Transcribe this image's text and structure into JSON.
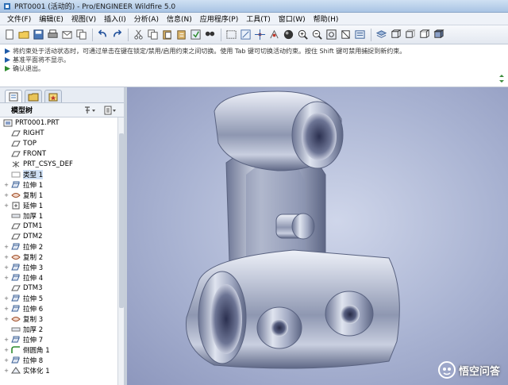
{
  "window": {
    "title": "PRT0001 (活动的) - Pro/ENGINEER Wildfire 5.0"
  },
  "menu": {
    "items": [
      "文件(F)",
      "编辑(E)",
      "视图(V)",
      "插入(I)",
      "分析(A)",
      "信息(N)",
      "应用程序(P)",
      "工具(T)",
      "窗口(W)",
      "帮助(H)"
    ]
  },
  "toolbar": {
    "icons": [
      "new-icon",
      "open-icon",
      "save-icon",
      "print-icon",
      "email-icon",
      "copy-icon",
      "undo-icon",
      "redo-icon",
      "cut-icon",
      "copy-icon",
      "paste-icon",
      "paste-special-icon",
      "regenerate-icon",
      "find-icon",
      "select-box-icon",
      "repaint-icon",
      "spin-center-icon",
      "orient-icon",
      "appearance-icon",
      "zoom-in-icon",
      "zoom-out-icon",
      "refit-icon",
      "reorient-icon",
      "saved-views-icon",
      "layers-icon",
      "wireframe-icon",
      "hidden-line-icon",
      "no-hidden-icon",
      "shading-icon"
    ]
  },
  "messages": {
    "lines": [
      "将约束处于活动状态时，可通过单击在键在锁定/禁用/启用约束之间切换。使用 Tab 键可切换活动约束。按住 Shift 键可禁用捕捉到新约束。",
      "基准平面将不显示。",
      "确认退出。"
    ]
  },
  "navigator": {
    "tabs": [
      "model-tree-tab-icon",
      "folder-browser-tab-icon",
      "favorites-tab-icon"
    ]
  },
  "model_tree": {
    "title": "模型树",
    "items": [
      {
        "label": "PRT0001.PRT",
        "icon": "part-icon",
        "expandable": false,
        "root": true
      },
      {
        "label": "RIGHT",
        "icon": "datum-plane-icon",
        "expandable": false
      },
      {
        "label": "TOP",
        "icon": "datum-plane-icon",
        "expandable": false
      },
      {
        "label": "FRONT",
        "icon": "datum-plane-icon",
        "expandable": false
      },
      {
        "label": "PRT_CSYS_DEF",
        "icon": "csys-icon",
        "expandable": false
      },
      {
        "label": "类型 1",
        "icon": "type-icon",
        "expandable": false,
        "selected": true
      },
      {
        "label": "拉伸 1",
        "icon": "extrude-icon",
        "expandable": true
      },
      {
        "label": "复制 1",
        "icon": "copy-feature-icon",
        "expandable": true
      },
      {
        "label": "延伸 1",
        "icon": "extend-icon",
        "expandable": true
      },
      {
        "label": "加厚 1",
        "icon": "thicken-icon",
        "expandable": false
      },
      {
        "label": "DTM1",
        "icon": "datum-plane-icon",
        "expandable": false
      },
      {
        "label": "DTM2",
        "icon": "datum-plane-icon",
        "expandable": false
      },
      {
        "label": "拉伸 2",
        "icon": "extrude-icon",
        "expandable": true
      },
      {
        "label": "复制 2",
        "icon": "copy-feature-icon",
        "expandable": true
      },
      {
        "label": "拉伸 3",
        "icon": "extrude-icon",
        "expandable": true
      },
      {
        "label": "拉伸 4",
        "icon": "extrude-icon",
        "expandable": true
      },
      {
        "label": "DTM3",
        "icon": "datum-plane-icon",
        "expandable": false
      },
      {
        "label": "拉伸 5",
        "icon": "extrude-icon",
        "expandable": true
      },
      {
        "label": "拉伸 6",
        "icon": "extrude-icon",
        "expandable": true
      },
      {
        "label": "复制 3",
        "icon": "copy-feature-icon",
        "expandable": true
      },
      {
        "label": "加厚 2",
        "icon": "thicken-icon",
        "expandable": false
      },
      {
        "label": "拉伸 7",
        "icon": "extrude-icon",
        "expandable": true
      },
      {
        "label": "倒圆角 1",
        "icon": "round-icon",
        "expandable": true
      },
      {
        "label": "拉伸 8",
        "icon": "extrude-icon",
        "expandable": true
      },
      {
        "label": "实体化 1",
        "icon": "solidify-icon",
        "expandable": true
      }
    ]
  },
  "watermark": {
    "text": "悟空问答"
  },
  "colors": {
    "viewport_center": "#cfd6ea",
    "viewport_edge": "#8d97bd",
    "part_metal": "#a9b2c8"
  }
}
